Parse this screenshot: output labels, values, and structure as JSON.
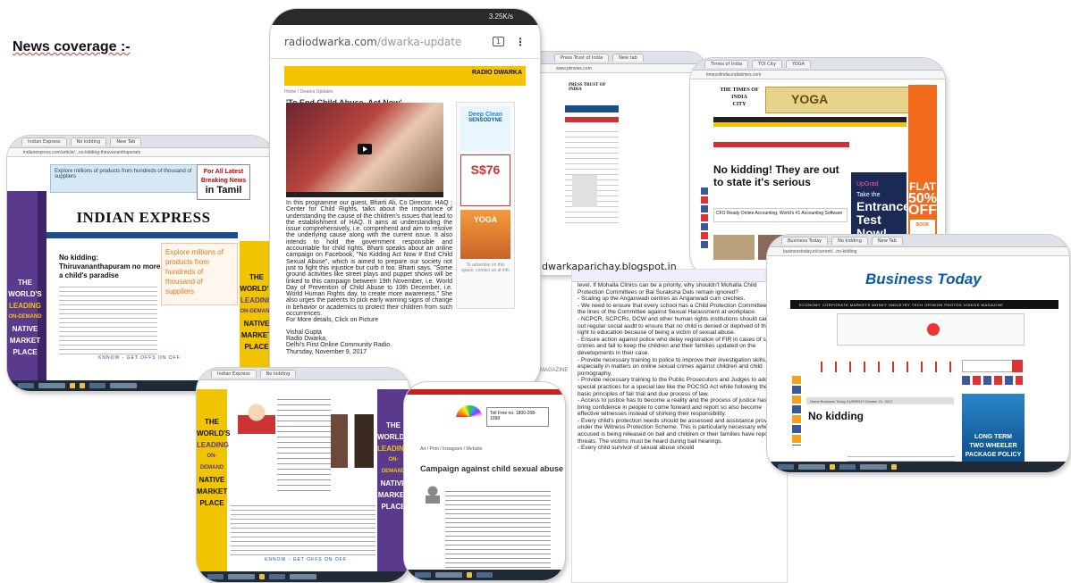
{
  "heading": "News coverage :-",
  "colors": {
    "ie_purple": "#5a3a8c",
    "ie_yellow": "#f1c400",
    "radio_yellow": "#f5c400",
    "toi_orange": "#f26a1b",
    "bt_blue": "#0a5aa7",
    "mag_red": "#c81e1e"
  },
  "indian_express": {
    "masthead": "INDIAN EXPRESS",
    "top_banner": "Explore millions of products from hundreds of thousand of suppliers",
    "tamil_ad": {
      "line1": "For All Latest",
      "line2": "Breaking News",
      "line3": "in Tamil"
    },
    "headline": "No kidding: Thiruvananthapuram no more a child's paradise",
    "promo": {
      "line1": "THE",
      "line2": "WORLD'S",
      "line3": "LEADING",
      "line4": "ON-DEMAND",
      "line5": "NATIVE",
      "line6": "MARKET",
      "line7": "PLACE"
    },
    "ad_text": "Explore millions of products from hundreds of thousand of suppliers",
    "footer_link": "KNNOW - GET OFFS ON OFF"
  },
  "radiodwarka": {
    "status": "3.25K/s",
    "domain": "radiodwarka.com",
    "path": "/dwarka-update",
    "logo": "RADIO DWARKA",
    "crumb": "Home / Dwarka Updates",
    "title": "'To End Child Abuse, Act Now'",
    "ads": {
      "deep_clean": "Deep Clean",
      "brand": "SENSODYNE",
      "price": "S$76",
      "yoga": "YOGA",
      "small": "To advertise on this space, contact us at info"
    },
    "body": "In this programme our guest, Bharti Ali, Co Director, HAQ : Center for Child Rights, talks about the importance of understanding the cause of the children's issues that lead to the establishment of HAQ. It aims at understanding the issue comprehensively, i.e. comprehend and aim to resolve the underlying cause along with the current issue. It also intends to hold the government responsible and accountable for child rights. Bharti speaks about an online campaign on Facebook, \"No Kidding Act Now # End Child Sexual Abuse\", which is aimed to prepare our society not just to fight this injustice but curb it too. Bharti says, \"Some ground activities like street plays and puppet shows will be linked to this campaign between 19th November, i.e. World Day of Prevention of Child Abuse to 10th December, i.e. World Human Rights day, to create more awareness.\" She also urges the parents to pick early warning signs of change in behavior or academics to protect their children from such occurrences.",
    "more": "For More details, Click on Picture",
    "signoff": "Vishal Gupta",
    "station": "Radio Dwarka,",
    "tagline": "Delhi's First Online Community Radio.",
    "date": "Thursday, November 9, 2017"
  },
  "blog": "dwarkaparichay.blogspot.in",
  "pti": {
    "name": "PRESS TRUST OF INDIA"
  },
  "toi": {
    "masthead": "THE TIMES OF INDIA",
    "edition": "CITY",
    "ad": "YOGA",
    "headline": "No kidding! They are out to state it's serious",
    "upgrad": {
      "brand": "UpGrad",
      "line1": "Take the",
      "line2": "Entrance",
      "line3": "Test",
      "line4": "Now!"
    },
    "side_ad": {
      "line1": "FLAT",
      "line2": "50%",
      "line3": "OFF",
      "line4": "BOOK NOW"
    },
    "lead": "CFO Ready Online Accounting. World's #1 Accounting Software"
  },
  "business_today": {
    "masthead": "Business Today",
    "nav": "ECONOMY  CORPORATE  MARKETS  MONEY  INDUSTRY  TECH  OPINION  PHOTOS  VIDEOS  MAGAZINE",
    "category": "Home  Business Today  CURRENT  October 21, 2017",
    "headline": "No kidding",
    "ad": {
      "line1": "LONG TERM",
      "line2": "TWO WHEELER",
      "line3": "PACKAGE POLICY"
    }
  },
  "magazine": {
    "label": "MAGAZINE",
    "helpline": "Toll Free no. 1800-208-1098",
    "section": "Art / Print / Instagram / Website",
    "title": "Campaign against child sexual abuse"
  },
  "ncpcr_text": "level. If Mohalla Clinics can be a priority, why shouldn't Mohalla Child Protection Committees or Bal Suraksha Dals remain ignored?\n- Scaling up the Anganwadi centres as Anganwadi cum creches.\n- We need to ensure that every school has a Child Protection Committee on the lines of the Committee against Sexual Harassment at workplace.\n- NCPCR, SCPCRs, DCW and other human rights institutions should carry out regular social audit to ensure that no child is denied or deprived of their right to education because of being a victim of sexual abuse.\n- Ensure action against police who delay registration of FIR in cases of sexual crimes and fail to keep the children and their families updated on the developments in their case.\n- Provide necessary training to police to improve their investigation skills, especially in matters on online sexual crimes against children and child pornography.\n- Provide necessary training to the Public Prosecutors and Judges to adopt special practices for a special law like the POCSO Act while following the basic principles of fair trial and due process of law.\n- Access to justice has to become a reality and the process of justice has to bring confidence in people to come forward and report so also become effective witnesses instead of shirking their responsibility.\n- Every child's protection needs should be assessed and assistance provided under the Witness Protection Scheme. This is particularly necessary when the accused is being released on bail and children or their families have reported threats. The victims must be heard during bail hearings.\n- Every child survivor of sexual abuse should"
}
